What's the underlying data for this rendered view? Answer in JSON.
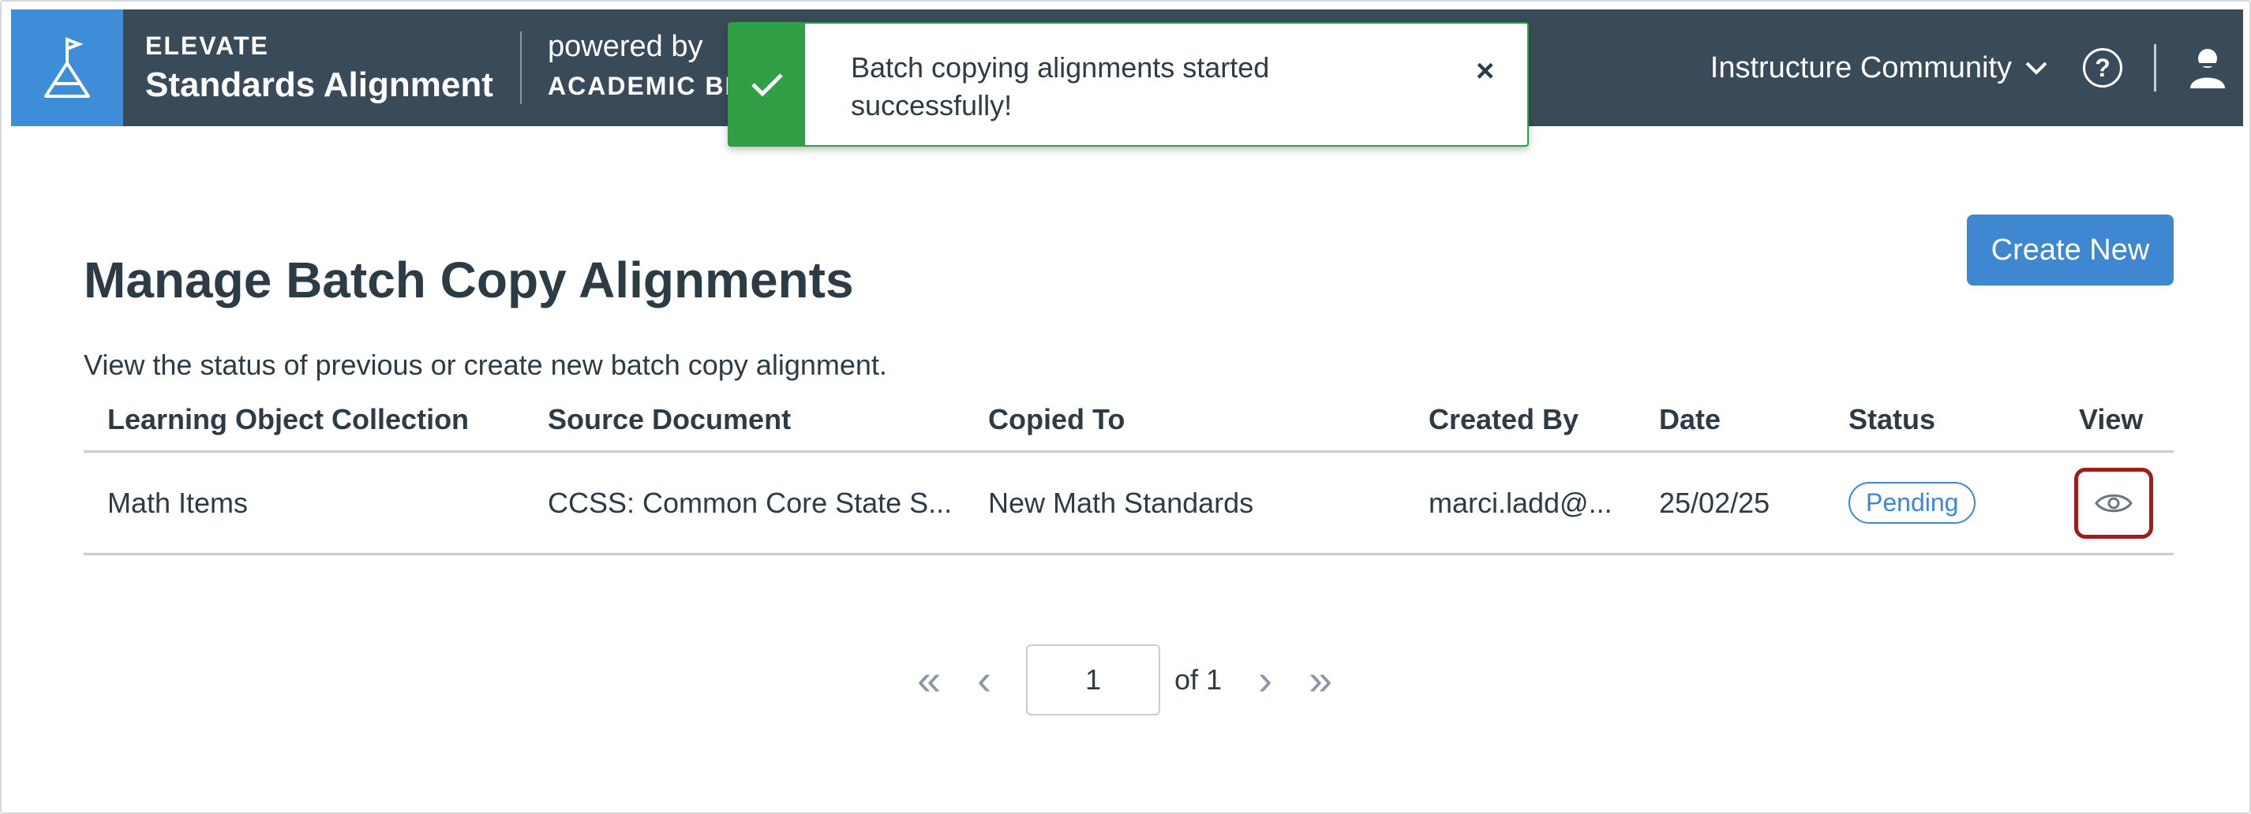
{
  "header": {
    "brand_small": "ELEVATE",
    "brand_title": "Standards Alignment",
    "powered_by": "powered by",
    "powered_company": "ACADEMIC BE",
    "community_label": "Instructure Community",
    "help_label": "?"
  },
  "toast": {
    "message": "Batch copying alignments started successfully!",
    "close_label": "×"
  },
  "page": {
    "title": "Manage Batch Copy Alignments",
    "description": "View the status of previous or create new batch copy alignment.",
    "create_button": "Create New"
  },
  "table": {
    "headers": [
      "Learning Object Collection",
      "Source Document",
      "Copied To",
      "Created By",
      "Date",
      "Status",
      "View"
    ],
    "rows": [
      {
        "collection": "Math Items",
        "source": "CCSS: Common Core State S...",
        "copied_to": "New Math Standards",
        "created_by": "marci.ladd@...",
        "date": "25/02/25",
        "status": "Pending"
      }
    ]
  },
  "pagination": {
    "current_page": "1",
    "of_label": "of 1",
    "first": "«",
    "prev": "‹",
    "next": "›",
    "last": "»"
  },
  "colors": {
    "topbar": "#394b58",
    "logo_bg": "#3d8dd9",
    "toast_green": "#2f9e44",
    "primary_blue": "#3f87d0",
    "highlight_red": "#a01c1c"
  },
  "icons": {
    "logo": "flag-flask-icon",
    "chevron": "chevron-down-icon",
    "help": "help-circle-icon",
    "user": "user-icon",
    "toast_check": "checkmark-icon",
    "view": "eye-icon"
  }
}
